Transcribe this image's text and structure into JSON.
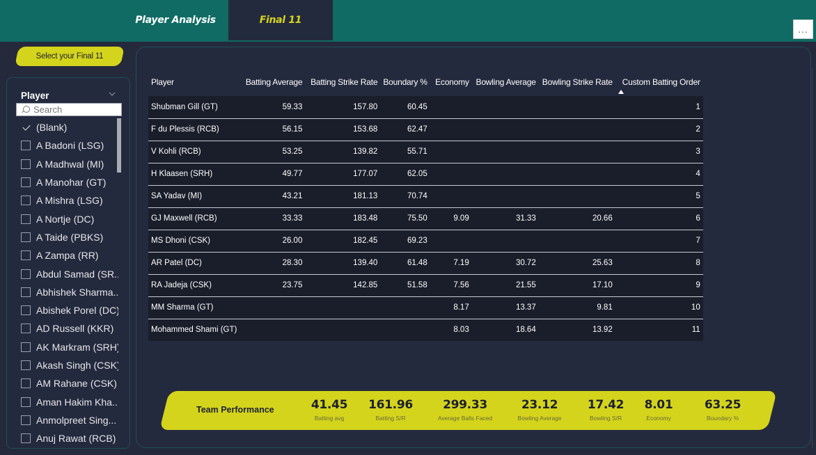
{
  "nav": {
    "tabs": [
      {
        "label": "Player Analysis"
      },
      {
        "label": "Final 11"
      }
    ],
    "more_label": "..."
  },
  "slicer": {
    "button_label": "Select your Final 11",
    "header": "Player",
    "search_placeholder": "Search",
    "items": [
      {
        "label": "(Blank)",
        "checked": true
      },
      {
        "label": "A Badoni (LSG)",
        "checked": false
      },
      {
        "label": "A Madhwal (MI)",
        "checked": false
      },
      {
        "label": "A Manohar (GT)",
        "checked": false
      },
      {
        "label": "A Mishra (LSG)",
        "checked": false
      },
      {
        "label": "A Nortje (DC)",
        "checked": false
      },
      {
        "label": "A Taide (PBKS)",
        "checked": false
      },
      {
        "label": "A Zampa (RR)",
        "checked": false
      },
      {
        "label": "Abdul Samad (SR...",
        "checked": false
      },
      {
        "label": "Abhishek Sharma...",
        "checked": false
      },
      {
        "label": "Abishek Porel (DC)",
        "checked": false
      },
      {
        "label": "AD Russell (KKR)",
        "checked": false
      },
      {
        "label": "AK Markram (SRH)",
        "checked": false
      },
      {
        "label": "Akash Singh (CSK)",
        "checked": false
      },
      {
        "label": "AM Rahane (CSK)",
        "checked": false
      },
      {
        "label": "Aman Hakim Kha...",
        "checked": false
      },
      {
        "label": "Anmolpreet Sing...",
        "checked": false
      },
      {
        "label": "Anuj Rawat (RCB)",
        "checked": false
      }
    ]
  },
  "table": {
    "columns": [
      "Player",
      "Batting Average",
      "Batting Strike Rate",
      "Boundary %",
      "Economy",
      "Bowling Average",
      "Bowling Strike Rate",
      "Custom Batting Order"
    ],
    "rows": [
      [
        "Shubman Gill (GT)",
        "59.33",
        "157.80",
        "60.45",
        "",
        "",
        "",
        "1"
      ],
      [
        "F du Plessis (RCB)",
        "56.15",
        "153.68",
        "62.47",
        "",
        "",
        "",
        "2"
      ],
      [
        "V Kohli (RCB)",
        "53.25",
        "139.82",
        "55.71",
        "",
        "",
        "",
        "3"
      ],
      [
        "H Klaasen (SRH)",
        "49.77",
        "177.07",
        "62.05",
        "",
        "",
        "",
        "4"
      ],
      [
        "SA Yadav (MI)",
        "43.21",
        "181.13",
        "70.74",
        "",
        "",
        "",
        "5"
      ],
      [
        "GJ Maxwell (RCB)",
        "33.33",
        "183.48",
        "75.50",
        "9.09",
        "31.33",
        "20.66",
        "6"
      ],
      [
        "MS Dhoni (CSK)",
        "26.00",
        "182.45",
        "69.23",
        "",
        "",
        "",
        "7"
      ],
      [
        "AR Patel (DC)",
        "28.30",
        "139.40",
        "61.48",
        "7.19",
        "30.72",
        "25.63",
        "8"
      ],
      [
        "RA Jadeja (CSK)",
        "23.75",
        "142.85",
        "51.58",
        "7.56",
        "21.55",
        "17.10",
        "9"
      ],
      [
        "MM Sharma (GT)",
        "",
        "",
        "",
        "8.17",
        "13.37",
        "9.81",
        "10"
      ],
      [
        "Mohammed Shami (GT)",
        "",
        "",
        "",
        "8.03",
        "18.64",
        "13.92",
        "11"
      ]
    ]
  },
  "performance": {
    "title": "Team Performance",
    "kpis": [
      {
        "value": "41.45",
        "label": "Batting avg"
      },
      {
        "value": "161.96",
        "label": "Batting S/R"
      },
      {
        "value": "299.33",
        "label": "Average Balls Faced"
      },
      {
        "value": "23.12",
        "label": "Bowling Average"
      },
      {
        "value": "17.42",
        "label": "Bowling S/R"
      },
      {
        "value": "8.01",
        "label": "Economy"
      },
      {
        "value": "63.25",
        "label": "Boundary %"
      }
    ]
  },
  "colors": {
    "teal": "#0f6b63",
    "accent_yellow": "#d4d41c",
    "panel_bg": "#242a3e",
    "row_bg": "#1a1e2b"
  }
}
